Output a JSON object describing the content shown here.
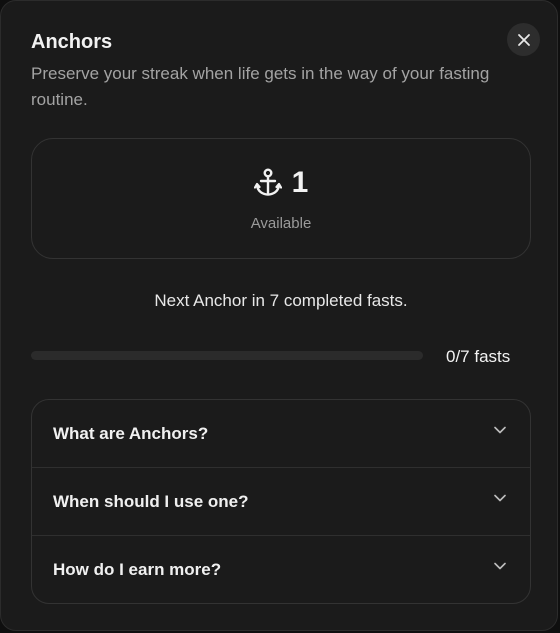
{
  "dialog": {
    "title": "Anchors",
    "subtitle": "Preserve your streak when life gets in the way of your fasting routine.",
    "close_icon": "close-icon"
  },
  "anchors": {
    "icon": "anchor-icon",
    "count": "1",
    "available_label": "Available"
  },
  "progress": {
    "next_text": "Next Anchor in 7 completed fasts.",
    "completed": 0,
    "goal": 7,
    "label": "0/7 fasts"
  },
  "faq": {
    "items": [
      {
        "label": "What are Anchors?",
        "icon": "chevron-down-icon"
      },
      {
        "label": "When should I use one?",
        "icon": "chevron-down-icon"
      },
      {
        "label": "How do I earn more?",
        "icon": "chevron-down-icon"
      }
    ]
  }
}
